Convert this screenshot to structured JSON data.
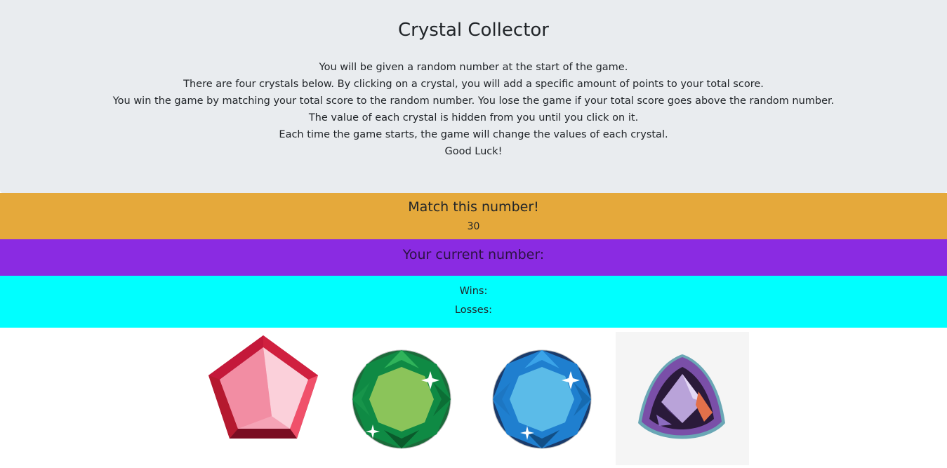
{
  "header": {
    "title": "Crystal Collector",
    "instructions": [
      "You will be given a random number at the start of the game.",
      "There are four crystals below. By clicking on a crystal, you will add a specific amount of points to your total score.",
      "You win the game by matching your total score to the random number. You lose the game if your total score goes above the random number.",
      "The value of each crystal is hidden from you until you click on it.",
      "Each time the game starts, the game will change the values of each crystal.",
      "Good Luck!"
    ]
  },
  "target": {
    "label": "Match this number!",
    "value": "30"
  },
  "current": {
    "label": "Your current number:",
    "value": ""
  },
  "score": {
    "wins_label": "Wins:",
    "wins_value": "",
    "losses_label": "Losses:",
    "losses_value": ""
  },
  "crystals": [
    {
      "name": "red-pentagon-crystal",
      "color": "#e8304e"
    },
    {
      "name": "green-round-crystal",
      "color": "#1fa045"
    },
    {
      "name": "blue-round-crystal",
      "color": "#2f8fd8"
    },
    {
      "name": "purple-trillion-crystal",
      "color": "#7a4fa8"
    }
  ]
}
